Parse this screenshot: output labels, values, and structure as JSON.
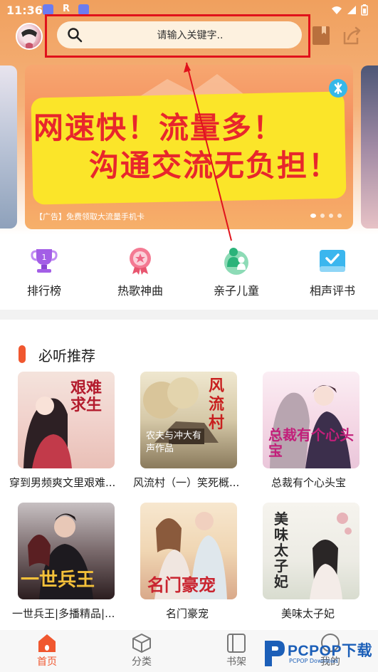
{
  "status_bar": {
    "time": "11:36",
    "carrier_letter": "R"
  },
  "header": {
    "search_placeholder": "请输入关键字.."
  },
  "banner": {
    "headline_1": "网速快！流量多！",
    "headline_2": "沟通交流无负担！",
    "caption": "【广告】免费领取大流量手机卡",
    "dots": 4,
    "active_dot": 0
  },
  "categories": [
    {
      "label": "排行榜",
      "icon": "trophy-icon"
    },
    {
      "label": "热歌神曲",
      "icon": "star-badge-icon"
    },
    {
      "label": "亲子儿童",
      "icon": "parent-child-icon"
    },
    {
      "label": "相声评书",
      "icon": "book-check-icon"
    }
  ],
  "section": {
    "title": "必听推荐"
  },
  "books": [
    {
      "title": "穿到男频爽文里艰难...",
      "cover_text": "艰难求生"
    },
    {
      "title": "风流村（一）笑死概...",
      "cover_text": "风流村",
      "cover_caption": "农夫与冲大有声作品"
    },
    {
      "title": "总裁有个心头宝",
      "cover_text": "总裁有个心头宝"
    },
    {
      "title": "一世兵王|多播精品|...",
      "cover_text": "一世兵王"
    },
    {
      "title": "名门豪宠",
      "cover_text": "名门豪宠"
    },
    {
      "title": "美味太子妃",
      "cover_text": "美味太子妃"
    }
  ],
  "bottom_nav": [
    {
      "label": "首页",
      "icon": "home-icon",
      "active": true
    },
    {
      "label": "分类",
      "icon": "cube-icon",
      "active": false
    },
    {
      "label": "书架",
      "icon": "bookshelf-icon",
      "active": false
    },
    {
      "label": "我的",
      "icon": "user-icon",
      "active": false
    }
  ],
  "watermark": {
    "text": "PCPOP下载",
    "sub": "PCPOP Download"
  },
  "colors": {
    "accent": "#f0572f",
    "annotation_red": "#e0121b",
    "search_bg": "#fdf1df",
    "banner_yellow": "#fbe529"
  }
}
